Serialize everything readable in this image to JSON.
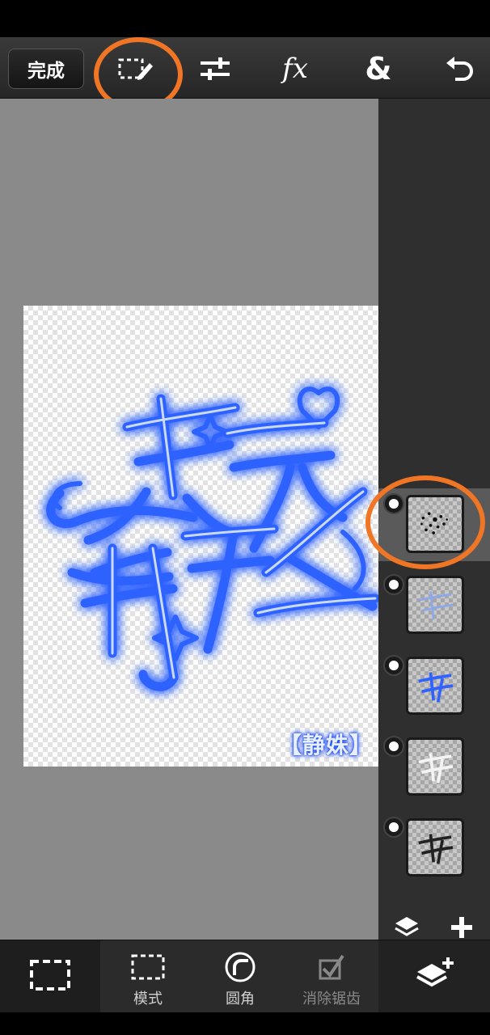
{
  "toolbar": {
    "done_label": "完成",
    "icons": [
      "selection-edit-icon",
      "adjustments-icon",
      "fx-icon",
      "blend-icon",
      "undo-icon"
    ],
    "fx_label": "fx",
    "blend_label": "&"
  },
  "canvas": {
    "signature": "【静姝】",
    "accent_color": "#2a5cff"
  },
  "layers": {
    "items": [
      {
        "name": "layer-1",
        "selected": true
      },
      {
        "name": "layer-2",
        "selected": false
      },
      {
        "name": "layer-3",
        "selected": false
      },
      {
        "name": "layer-4",
        "selected": false
      },
      {
        "name": "layer-5",
        "selected": false
      }
    ],
    "buttons": [
      "layers-stack-icon",
      "add-layer-icon"
    ]
  },
  "bottom_bar": {
    "select_tool_icon": "marquee-icon",
    "mode_label": "模式",
    "rounded_label": "圆角",
    "antialias_label": "消除锯齿",
    "layers_button_icon": "add-layers-icon"
  },
  "highlight_color": "#f07524"
}
